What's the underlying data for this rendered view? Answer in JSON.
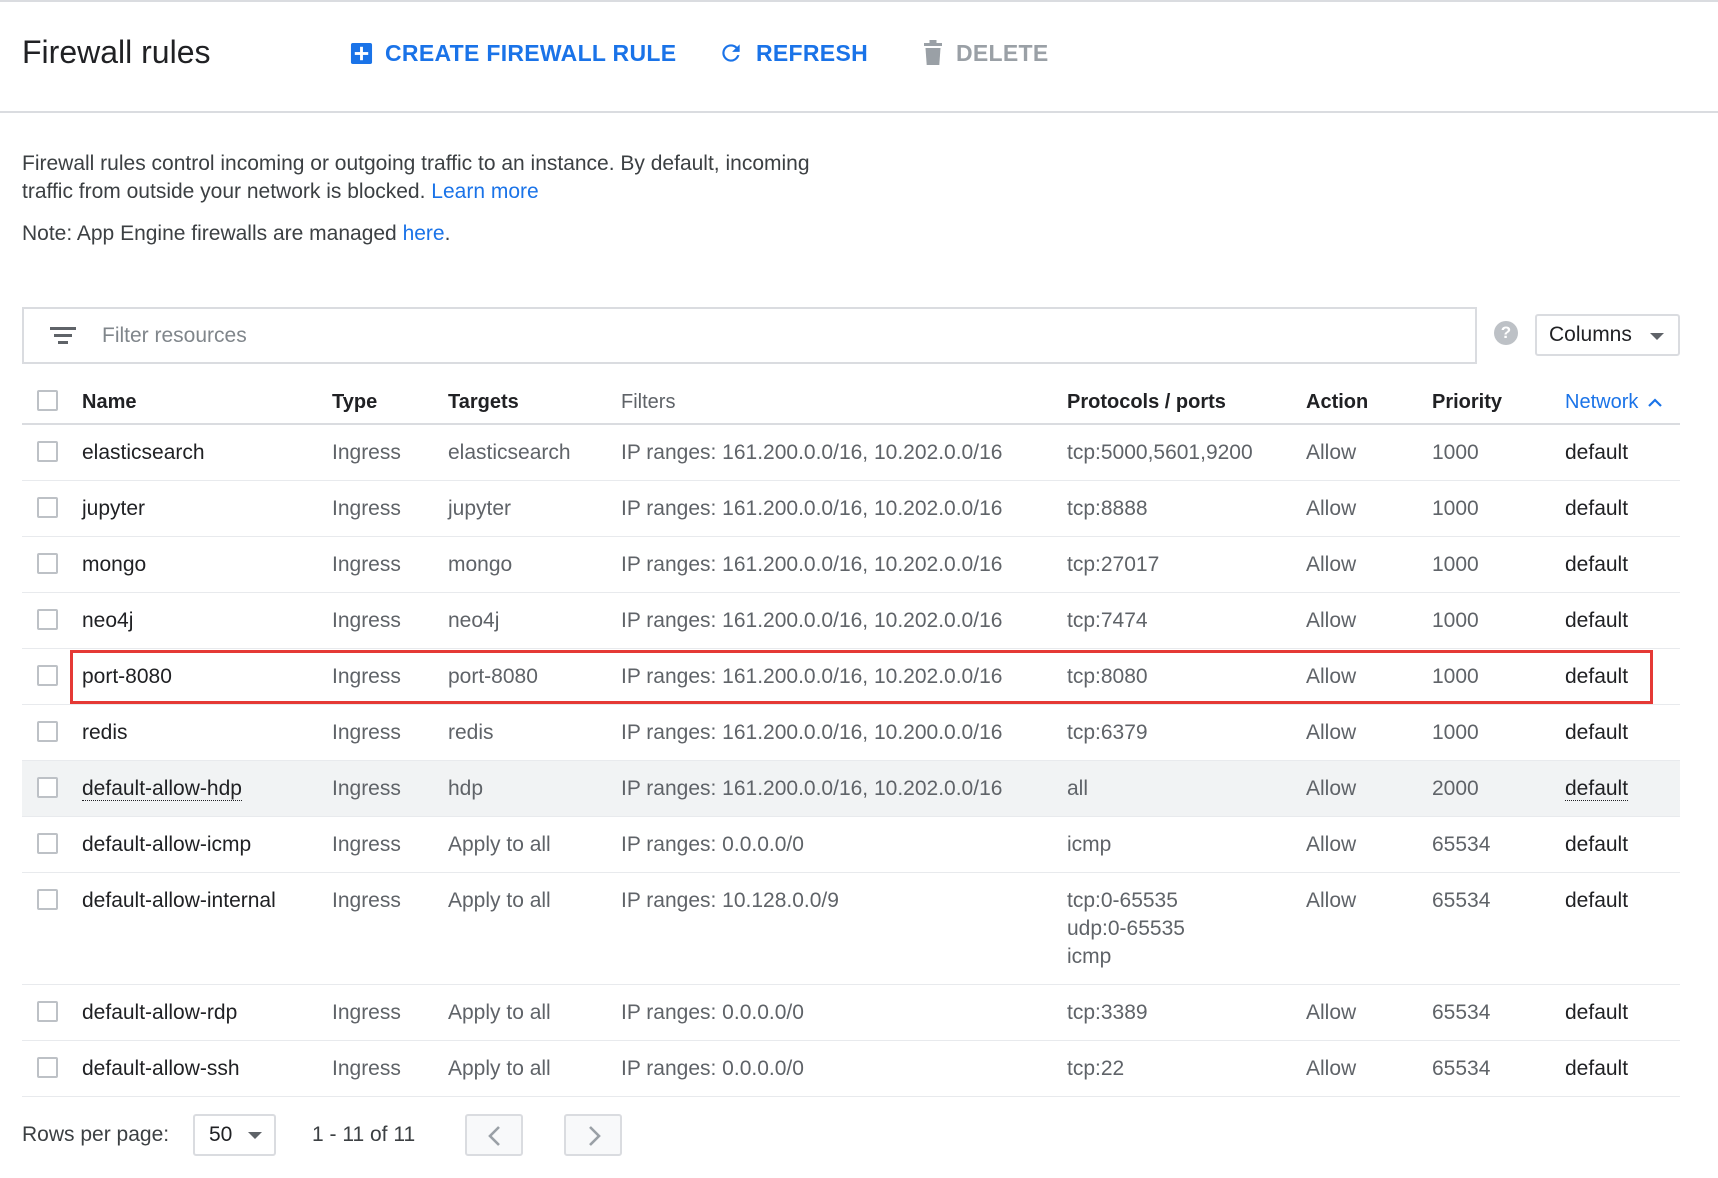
{
  "header": {
    "title": "Firewall rules",
    "create_label": "CREATE FIREWALL RULE",
    "refresh_label": "REFRESH",
    "delete_label": "DELETE"
  },
  "intro": {
    "text": "Firewall rules control incoming or outgoing traffic to an instance. By default, incoming traffic from outside your network is blocked.",
    "learn_more": "Learn more",
    "note_prefix": "Note: App Engine firewalls are managed ",
    "note_link": "here",
    "note_suffix": "."
  },
  "filter": {
    "placeholder": "Filter resources",
    "help_glyph": "?",
    "columns_label": "Columns"
  },
  "table": {
    "headers": {
      "name": "Name",
      "type": "Type",
      "targets": "Targets",
      "filters": "Filters",
      "protocols": "Protocols / ports",
      "action": "Action",
      "priority": "Priority",
      "network": "Network"
    },
    "rows": [
      {
        "name": "elasticsearch",
        "type": "Ingress",
        "targets": "elasticsearch",
        "filters": "IP ranges: 161.200.0.0/16, 10.202.0.0/16",
        "protocols": [
          "tcp:5000,5601,9200"
        ],
        "action": "Allow",
        "priority": "1000",
        "network": "default"
      },
      {
        "name": "jupyter",
        "type": "Ingress",
        "targets": "jupyter",
        "filters": "IP ranges: 161.200.0.0/16, 10.202.0.0/16",
        "protocols": [
          "tcp:8888"
        ],
        "action": "Allow",
        "priority": "1000",
        "network": "default"
      },
      {
        "name": "mongo",
        "type": "Ingress",
        "targets": "mongo",
        "filters": "IP ranges: 161.200.0.0/16, 10.202.0.0/16",
        "protocols": [
          "tcp:27017"
        ],
        "action": "Allow",
        "priority": "1000",
        "network": "default"
      },
      {
        "name": "neo4j",
        "type": "Ingress",
        "targets": "neo4j",
        "filters": "IP ranges: 161.200.0.0/16, 10.202.0.0/16",
        "protocols": [
          "tcp:7474"
        ],
        "action": "Allow",
        "priority": "1000",
        "network": "default"
      },
      {
        "name": "port-8080",
        "type": "Ingress",
        "targets": "port-8080",
        "filters": "IP ranges: 161.200.0.0/16, 10.202.0.0/16",
        "protocols": [
          "tcp:8080"
        ],
        "action": "Allow",
        "priority": "1000",
        "network": "default"
      },
      {
        "name": "redis",
        "type": "Ingress",
        "targets": "redis",
        "filters": "IP ranges: 161.200.0.0/16, 10.200.0.0/16",
        "protocols": [
          "tcp:6379"
        ],
        "action": "Allow",
        "priority": "1000",
        "network": "default"
      },
      {
        "name": "default-allow-hdp",
        "type": "Ingress",
        "targets": "hdp",
        "filters": "IP ranges: 161.200.0.0/16, 10.202.0.0/16",
        "protocols": [
          "all"
        ],
        "action": "Allow",
        "priority": "2000",
        "network": "default"
      },
      {
        "name": "default-allow-icmp",
        "type": "Ingress",
        "targets": "Apply to all",
        "filters": "IP ranges: 0.0.0.0/0",
        "protocols": [
          "icmp"
        ],
        "action": "Allow",
        "priority": "65534",
        "network": "default"
      },
      {
        "name": "default-allow-internal",
        "type": "Ingress",
        "targets": "Apply to all",
        "filters": "IP ranges: 10.128.0.0/9",
        "protocols": [
          "tcp:0-65535",
          "udp:0-65535",
          "icmp"
        ],
        "action": "Allow",
        "priority": "65534",
        "network": "default"
      },
      {
        "name": "default-allow-rdp",
        "type": "Ingress",
        "targets": "Apply to all",
        "filters": "IP ranges: 0.0.0.0/0",
        "protocols": [
          "tcp:3389"
        ],
        "action": "Allow",
        "priority": "65534",
        "network": "default"
      },
      {
        "name": "default-allow-ssh",
        "type": "Ingress",
        "targets": "Apply to all",
        "filters": "IP ranges: 0.0.0.0/0",
        "protocols": [
          "tcp:22"
        ],
        "action": "Allow",
        "priority": "65534",
        "network": "default"
      }
    ]
  },
  "pagination": {
    "rows_per_page_label": "Rows per page:",
    "rows_per_page_value": "50",
    "range_text": "1 - 11 of 11"
  },
  "colors": {
    "accent": "#1a73e8",
    "highlight": "#e53935",
    "muted_text": "#5f6368",
    "border": "#dadce0"
  },
  "icons": {
    "create": "add-box-icon",
    "refresh": "refresh-icon",
    "delete": "trash-icon",
    "filter": "filter-list-icon",
    "help": "help-icon",
    "sort": "chevron-up-icon",
    "prev": "chevron-left-icon",
    "next": "chevron-right-icon"
  }
}
